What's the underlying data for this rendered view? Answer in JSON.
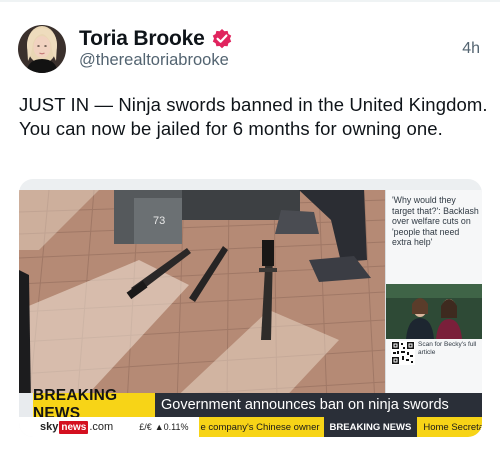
{
  "header": {
    "display_name": "Toria Brooke",
    "handle": "@therealtoriabrooke",
    "timestamp": "4h"
  },
  "tweet": {
    "text": "JUST IN — Ninja swords banned in the United Kingdom. You can now be jailed for 6 months for owning one."
  },
  "media": {
    "photo_label": "73",
    "side_panel": {
      "quote": "'Why would they target that?': Backlash over welfare cuts on 'people that need extra help'",
      "qr_text": "Scan for Becky's full article"
    },
    "lower_third": {
      "label": "BREAKING NEWS",
      "headline": "Government announces ban on ninja swords"
    },
    "ticker": {
      "brand_sky": "sky",
      "brand_news": "news",
      "brand_com": ".com",
      "fx": "£/€",
      "fx_change": "▲0.11%",
      "item_1": "e company's Chinese owner",
      "item_2": "BREAKING NEWS",
      "item_3": "Home Secretary Y"
    }
  },
  "colors": {
    "verified_badge": "#e0245e",
    "breaking_yellow": "#f7d417",
    "sky_red": "#d41020",
    "ticker_dark": "#2a2f38"
  },
  "icons": {
    "verified": "verified-badge-icon",
    "qr": "qr-code-icon"
  }
}
